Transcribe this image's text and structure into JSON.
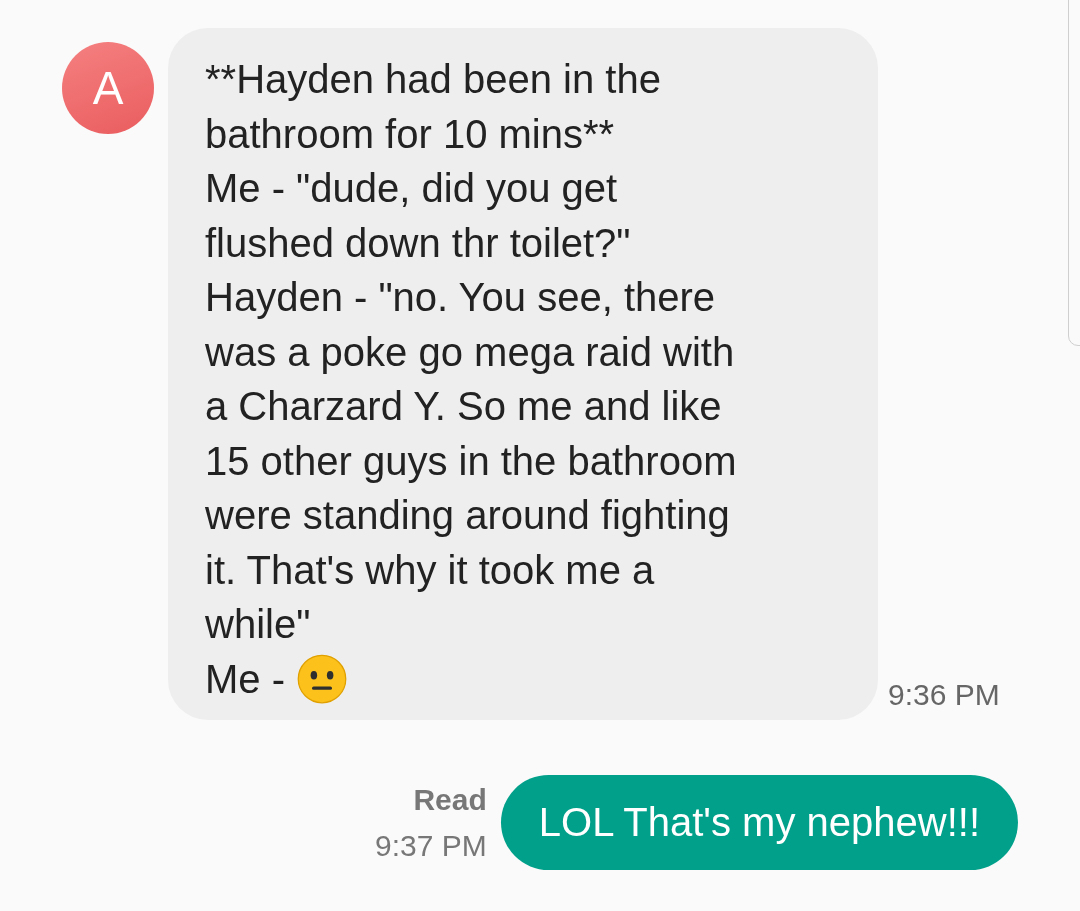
{
  "messages": [
    {
      "kind": "incoming",
      "avatar": "A",
      "text": "**Hayden had been in the\nbathroom for 10 mins**\nMe - \"dude, did you get\nflushed down thr toilet?\"\nHayden - \"no. You see, there\nwas a poke go mega raid with\na Charzard Y. So me and like\n15 other guys in the bathroom\nwere standing around fighting\nit. That's why it took me a\nwhile\"\nMe - ",
      "time": "9:36 PM"
    },
    {
      "kind": "outgoing",
      "status": "Read",
      "time": "9:37 PM",
      "text": "LOL That's my nephew!!!"
    }
  ]
}
